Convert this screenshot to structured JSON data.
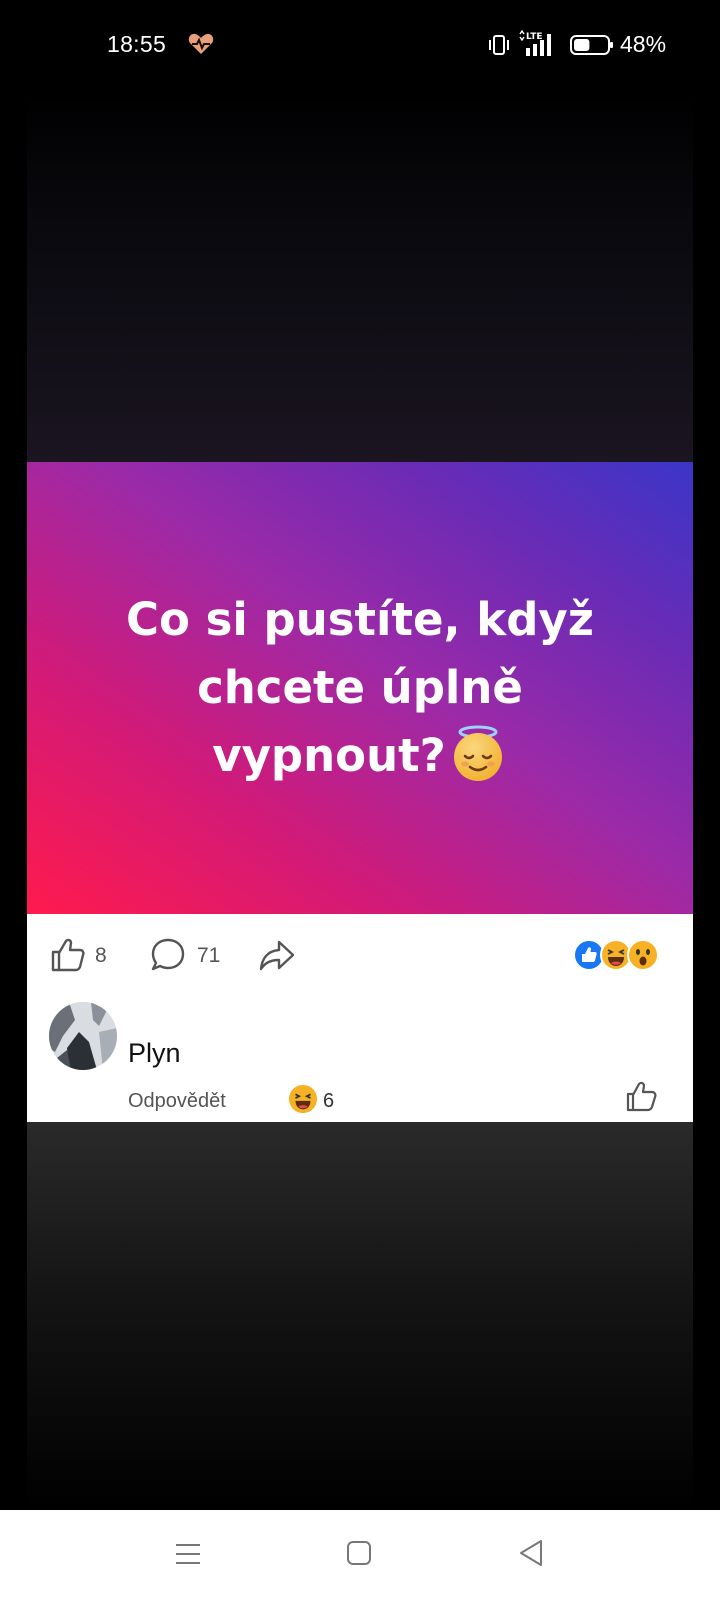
{
  "status_bar": {
    "time": "18:55",
    "battery_percent": "48%",
    "battery_level": 0.48,
    "network": "LTE",
    "icons": [
      "health-heart-icon",
      "vibrate-icon",
      "lte-signal-icon",
      "battery-icon"
    ]
  },
  "post": {
    "image_text_lines": [
      "Co si pustíte, když",
      "chcete úplně",
      "vypnout?"
    ],
    "image_emoji": "smiling-face-with-halo-emoji",
    "like_count": "8",
    "comment_count": "71",
    "reaction_icons": [
      "like-reaction-icon",
      "haha-reaction-icon",
      "wow-reaction-icon"
    ]
  },
  "comment": {
    "text": "Plyn",
    "reply_label": "Odpovědět",
    "reaction_count": "6",
    "reaction_icon": "haha-reaction-icon"
  },
  "nav_bar": {
    "icons": [
      "menu-icon",
      "home-icon",
      "back-icon"
    ]
  },
  "colors": {
    "gradient_start": "#ff1a4d",
    "gradient_end": "#3b35c8",
    "facebook_blue": "#1877f2",
    "reaction_yellow": "#f7b125"
  }
}
